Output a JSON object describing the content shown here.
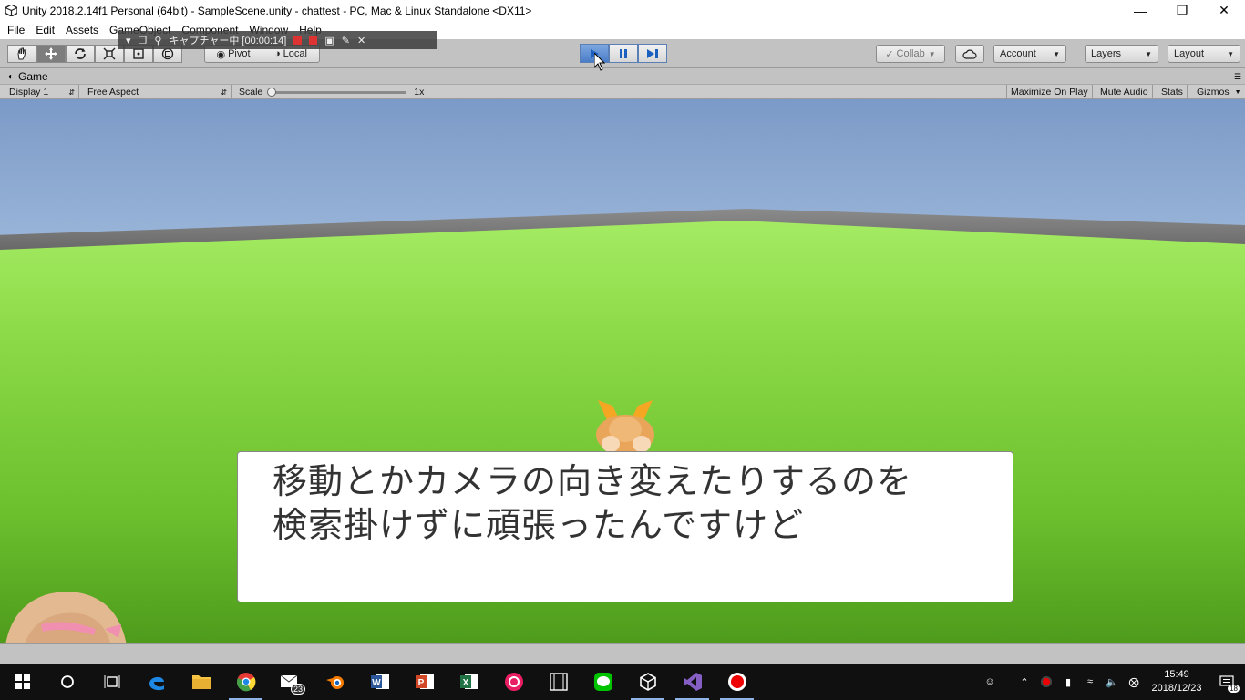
{
  "window": {
    "title": "Unity 2018.2.14f1 Personal (64bit) - SampleScene.unity - chattest - PC, Mac & Linux Standalone <DX11>"
  },
  "menu": [
    "File",
    "Edit",
    "Assets",
    "GameObject",
    "Component",
    "Window",
    "Help"
  ],
  "capture": {
    "label": "キャプチャー中 [00:00:14]"
  },
  "toolbar": {
    "pivot": "Pivot",
    "local": "Local",
    "collab": "Collab",
    "account": "Account",
    "layers": "Layers",
    "layout": "Layout"
  },
  "game_tab": {
    "title": "Game",
    "display": "Display 1",
    "aspect": "Free Aspect",
    "scale_label": "Scale",
    "scale_value": "1x",
    "maximize": "Maximize On Play",
    "mute": "Mute Audio",
    "stats": "Stats",
    "gizmos": "Gizmos"
  },
  "dialog": {
    "line1": "移動とかカメラの向き変えたりするのを",
    "line2": "検索掛けずに頑張ったんですけど"
  },
  "taskbar": {
    "mail_badge": "23",
    "time": "15:49",
    "date": "2018/12/23",
    "notif_count": "18"
  },
  "colors": {
    "play_active": "#4a7dc8",
    "ground": "#7fcf3a",
    "sky": "#a9c3e2"
  }
}
